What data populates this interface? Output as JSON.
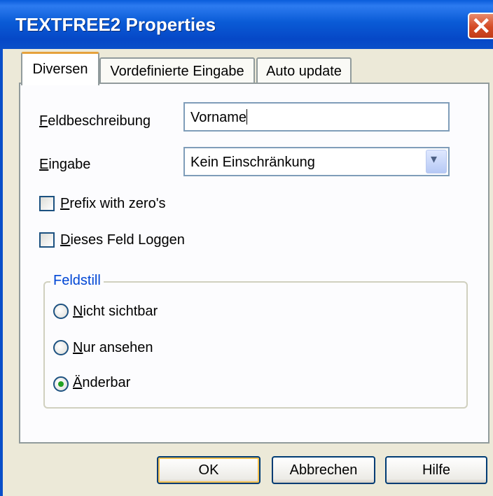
{
  "window": {
    "title": "TEXTFREE2 Properties",
    "close_symbol": "✕"
  },
  "tabs": [
    {
      "label": "Diversen",
      "active": true
    },
    {
      "label": "Vordefinierte Eingabe",
      "active": false
    },
    {
      "label": "Auto update",
      "active": false
    }
  ],
  "fields": {
    "description_label_mnemonic": "F",
    "description_label_rest": "eldbeschreibung",
    "description_value": "Vorname",
    "input_label_mnemonic": "E",
    "input_label_rest": "ingabe",
    "input_selected": "Kein Einschränkung"
  },
  "checkboxes": [
    {
      "mnemonic": "P",
      "rest": "refix with zero's",
      "checked": false
    },
    {
      "mnemonic": "D",
      "rest": "ieses Feld Loggen",
      "checked": false
    }
  ],
  "group": {
    "title": "Feldstill",
    "options": [
      {
        "mnemonic": "N",
        "rest": "icht sichtbar",
        "selected": false
      },
      {
        "mnemonic": "N",
        "rest": "ur ansehen",
        "selected": false
      },
      {
        "mnemonic": "Ä",
        "rest": "nderbar",
        "selected": true
      }
    ]
  },
  "buttons": {
    "ok": "OK",
    "cancel": "Abbrechen",
    "help": "Hilfe"
  },
  "colors": {
    "titlebar": "#0a5bd6",
    "group_title": "#0046d5",
    "radio_selected": "#21a121"
  }
}
